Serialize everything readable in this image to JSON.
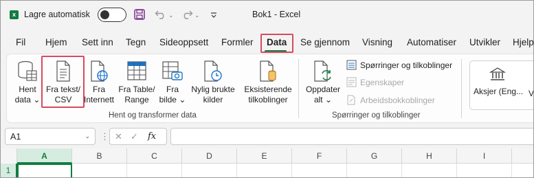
{
  "app": {
    "logo_letter": "x",
    "autosave_label": "Lagre automatisk",
    "document_title": "Bok1  -  Excel",
    "accent_color": "#107c41",
    "highlight_color": "#d9485f"
  },
  "tabs": [
    {
      "label": "Fil"
    },
    {
      "label": "Hjem"
    },
    {
      "label": "Sett inn"
    },
    {
      "label": "Tegn"
    },
    {
      "label": "Sideoppsett"
    },
    {
      "label": "Formler"
    },
    {
      "label": "Data",
      "active": true
    },
    {
      "label": "Se gjennom"
    },
    {
      "label": "Visning"
    },
    {
      "label": "Automatiser"
    },
    {
      "label": "Utvikler"
    },
    {
      "label": "Hjelp"
    }
  ],
  "ribbon": {
    "get_data": {
      "line1": "Hent",
      "line2": "data ⌄"
    },
    "from_text": {
      "line1": "Fra tekst/",
      "line2": "CSV"
    },
    "from_web": {
      "line1": "Fra",
      "line2": "Internett"
    },
    "from_table": {
      "line1": "Fra Table/",
      "line2": "Range"
    },
    "from_picture": {
      "line1": "Fra",
      "line2": "bilde ⌄"
    },
    "recent_sources": {
      "line1": "Nylig brukte",
      "line2": "kilder"
    },
    "existing_connections": {
      "line1": "Eksisterende",
      "line2": "tilkoblinger"
    },
    "group1_label": "Hent og transformer data",
    "refresh_all": {
      "line1": "Oppdater",
      "line2": "alt ⌄"
    },
    "queries_connections": "Spørringer og tilkoblinger",
    "properties": "Egenskaper",
    "workbook_links": "Arbeidsbokkoblinger",
    "group2_label": "Spørringer og tilkoblinger",
    "stocks_label": "Aksjer (Eng...",
    "stocks_more": "V"
  },
  "formula_bar": {
    "name_box": "A1",
    "fx": "fx",
    "formula_value": ""
  },
  "grid": {
    "columns": [
      "A",
      "B",
      "C",
      "D",
      "E",
      "F",
      "G",
      "H",
      "I"
    ],
    "rows": [
      "1"
    ],
    "selected_cell": "A1"
  }
}
